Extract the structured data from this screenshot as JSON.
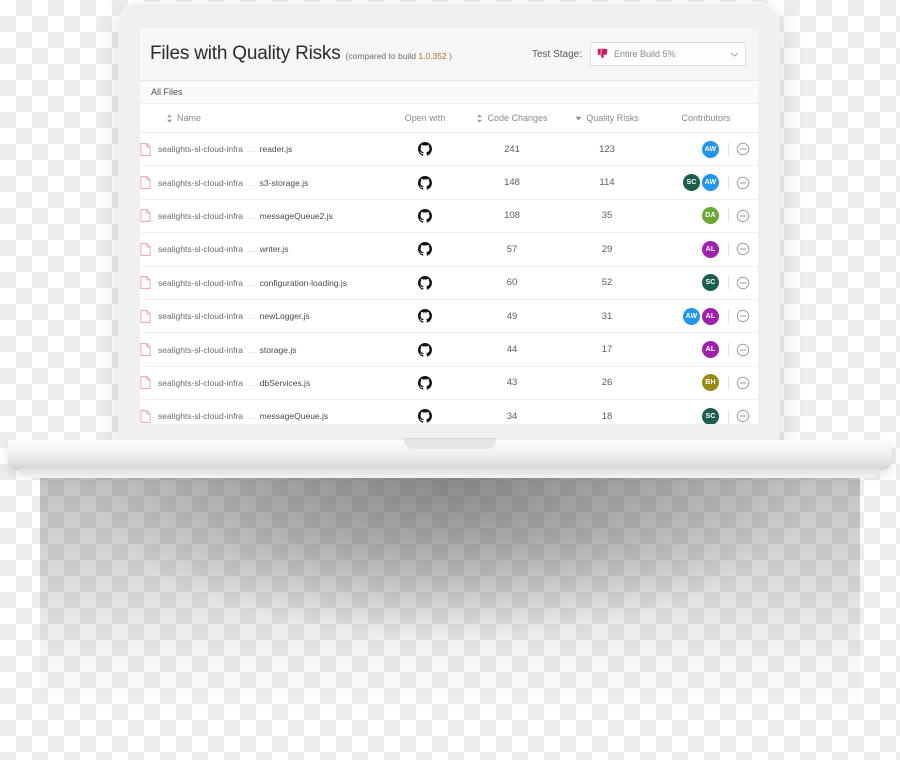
{
  "header": {
    "title": "Files with Quality Risks",
    "subtitle": "(compared to build 1.0.352 )",
    "subtitle_prefix": "(compared to build",
    "build_number": "1.0.352",
    "subtitle_suffix": ")",
    "stage_label": "Test Stage:",
    "stage_value": "Entire Build 5%",
    "stage_icon": "thumbs-down-icon",
    "chevron_icon": "chevron-down-icon"
  },
  "tabs": [
    {
      "label": "All Files",
      "active": true
    }
  ],
  "table": {
    "columns": [
      {
        "label": "Name",
        "sort": "both",
        "align": "left"
      },
      {
        "label": "Open with",
        "sort": "none",
        "align": "center"
      },
      {
        "label": "Code Changes",
        "sort": "both",
        "align": "center"
      },
      {
        "label": "Quality Risks",
        "sort": "desc",
        "align": "center"
      },
      {
        "label": "Contributors",
        "sort": "none",
        "align": "center"
      }
    ],
    "rows": [
      {
        "path": "sealights-sl-cloud-infra",
        "separator": "...",
        "file": "reader.js",
        "open_with": "github-icon",
        "code_changes": "241",
        "quality_risks": "123",
        "contributors": [
          {
            "initials": "AW",
            "color": "#2196f3"
          }
        ]
      },
      {
        "path": "sealights-sl-cloud-infra",
        "separator": "...",
        "file": "s3-storage.js",
        "open_with": "github-icon",
        "code_changes": "148",
        "quality_risks": "114",
        "contributors": [
          {
            "initials": "SC",
            "color": "#1c5e4e"
          },
          {
            "initials": "AW",
            "color": "#2196f3"
          }
        ]
      },
      {
        "path": "sealights-sl-cloud-infra",
        "separator": "...",
        "file": "messageQueue2.js",
        "open_with": "github-icon",
        "code_changes": "108",
        "quality_risks": "35",
        "contributors": [
          {
            "initials": "DA",
            "color": "#6aa832"
          }
        ]
      },
      {
        "path": "sealights-sl-cloud-infra",
        "separator": "...",
        "file": "writer.js",
        "open_with": "github-icon",
        "code_changes": "57",
        "quality_risks": "29",
        "contributors": [
          {
            "initials": "AL",
            "color": "#a020b0"
          }
        ]
      },
      {
        "path": "sealights-sl-cloud-infra",
        "separator": "...",
        "file": "configuration-loading.js",
        "open_with": "github-icon",
        "code_changes": "60",
        "quality_risks": "52",
        "contributors": [
          {
            "initials": "SC",
            "color": "#1c5e4e"
          }
        ]
      },
      {
        "path": "sealights-sl-cloud-infra",
        "separator": "...",
        "file": "newLogger.js",
        "open_with": "github-icon",
        "code_changes": "49",
        "quality_risks": "31",
        "contributors": [
          {
            "initials": "AW",
            "color": "#2196f3"
          },
          {
            "initials": "AL",
            "color": "#a020b0"
          }
        ]
      },
      {
        "path": "sealights-sl-cloud-infra",
        "separator": "...",
        "file": "storage.js",
        "open_with": "github-icon",
        "code_changes": "44",
        "quality_risks": "17",
        "contributors": [
          {
            "initials": "AL",
            "color": "#a020b0"
          }
        ]
      },
      {
        "path": "sealights-sl-cloud-infra",
        "separator": "...",
        "file": "dbServices.js",
        "open_with": "github-icon",
        "code_changes": "43",
        "quality_risks": "26",
        "contributors": [
          {
            "initials": "BH",
            "color": "#9a8b10"
          }
        ]
      },
      {
        "path": "sealights-sl-cloud-infra",
        "separator": "...",
        "file": "messageQueue.js",
        "open_with": "github-icon",
        "code_changes": "34",
        "quality_risks": "18",
        "contributors": [
          {
            "initials": "SC",
            "color": "#1c5e4e"
          }
        ]
      }
    ],
    "row_action_icon": "minus-circle-icon"
  },
  "colors": {
    "accent_pink": "#d81b60",
    "file_icon": "#f2a3a3",
    "build_number": "#b06a1d",
    "header_bg": "#f6f6f6"
  }
}
